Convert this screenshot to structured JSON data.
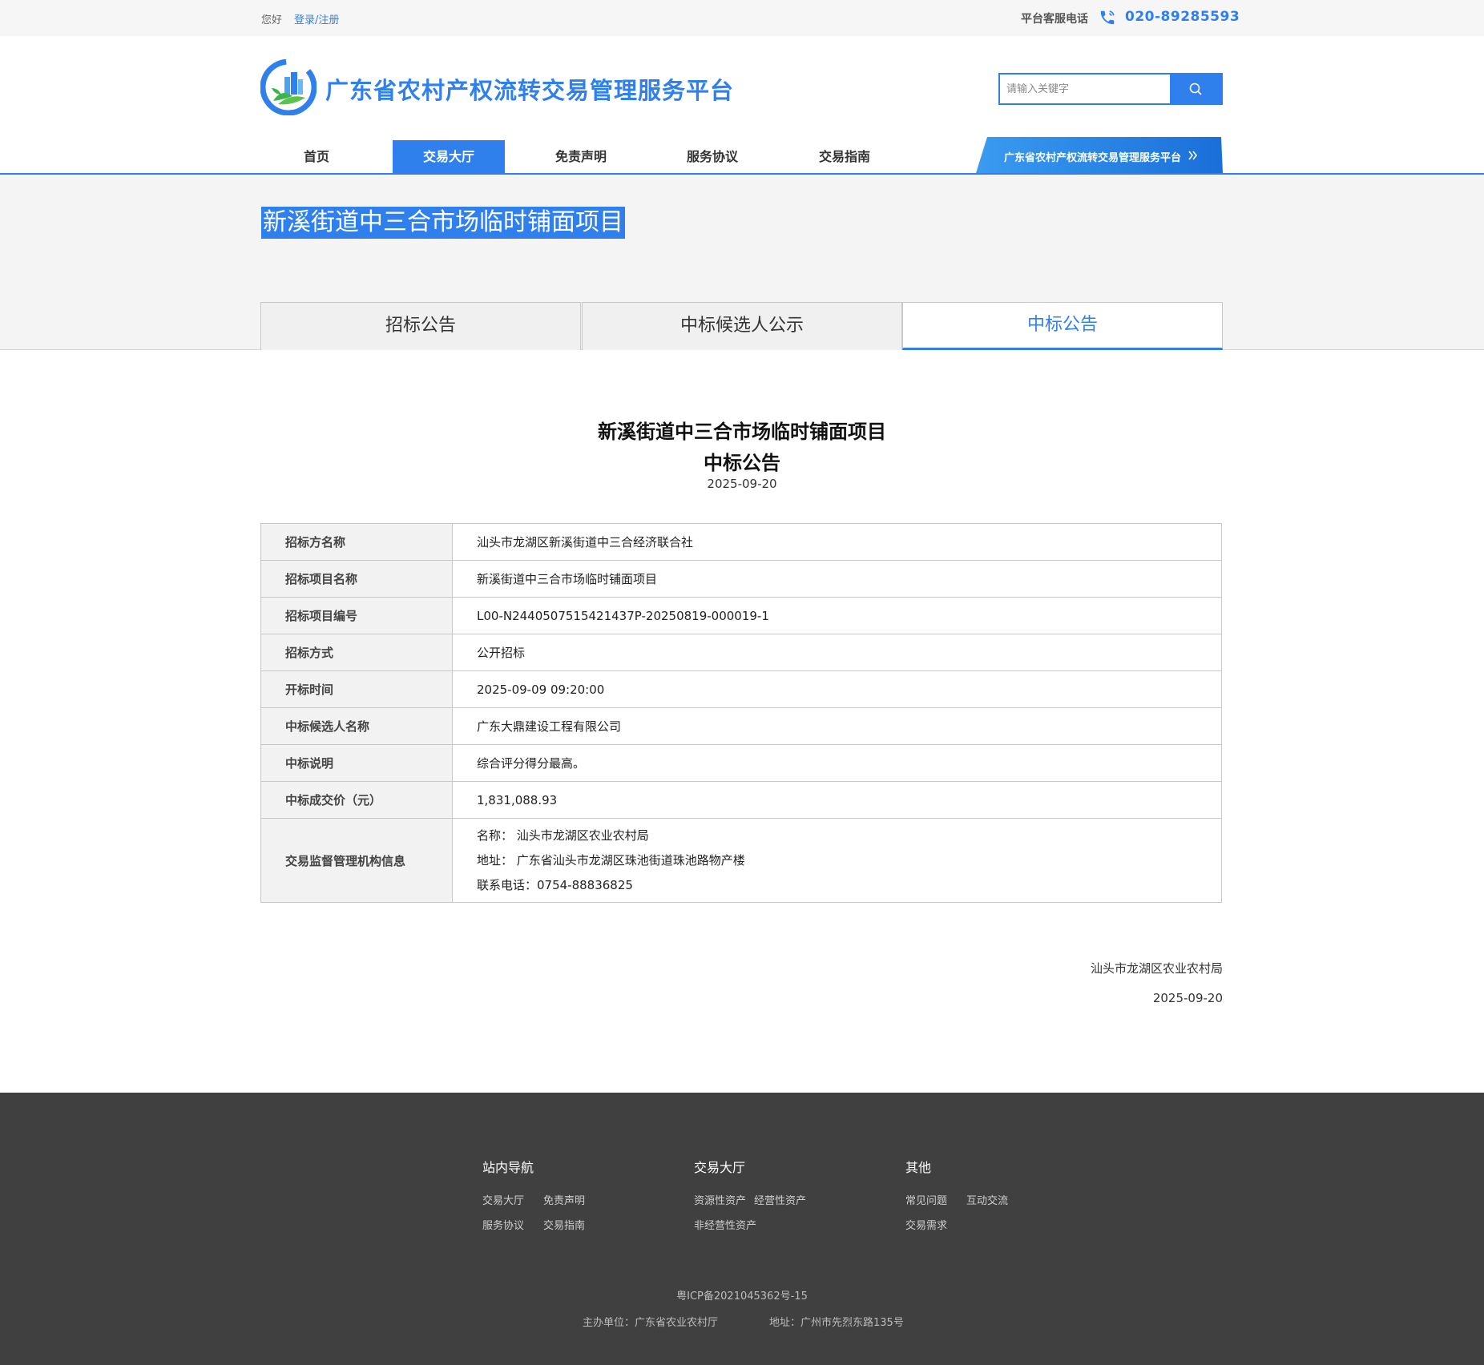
{
  "topbar": {
    "greeting": "您好",
    "login_link": "登录/注册",
    "hotline_label": "平台客服电话",
    "hotline_number": "020-89285593"
  },
  "header": {
    "site_title": "广东省农村产权流转交易管理服务平台",
    "logo_icon": "rural-platform-logo",
    "search_placeholder": "请输入关键字",
    "search_icon": "search-icon"
  },
  "nav": {
    "items": [
      {
        "label": "首页",
        "active": false
      },
      {
        "label": "交易大厅",
        "active": true
      },
      {
        "label": "免责声明",
        "active": false
      },
      {
        "label": "服务协议",
        "active": false
      },
      {
        "label": "交易指南",
        "active": false
      }
    ],
    "banner_label": "广东省农村产权流转交易管理服务平台"
  },
  "project": {
    "title": "新溪街道中三合市场临时铺面项目",
    "tabs": [
      {
        "label": "招标公告",
        "active": false
      },
      {
        "label": "中标候选人公示",
        "active": false
      },
      {
        "label": "中标公告",
        "active": true
      }
    ]
  },
  "notice": {
    "title_line1": "新溪街道中三合市场临时铺面项目",
    "title_line2": "中标公告",
    "date": "2025-09-20",
    "rows": [
      {
        "key": "招标方名称",
        "value": "汕头市龙湖区新溪街道中三合经济联合社"
      },
      {
        "key": "招标项目名称",
        "value": "新溪街道中三合市场临时铺面项目"
      },
      {
        "key": "招标项目编号",
        "value": "L00-N2440507515421437P-20250819-000019-1"
      },
      {
        "key": "招标方式",
        "value": "公开招标"
      },
      {
        "key": "开标时间",
        "value": "2025-09-09 09:20:00"
      },
      {
        "key": "中标候选人名称",
        "value": "广东大鼎建设工程有限公司"
      },
      {
        "key": "中标说明",
        "value": "综合评分得分最高。"
      },
      {
        "key": "中标成交价（元）",
        "value": "1,831,088.93"
      }
    ],
    "supervisor": {
      "key": "交易监督管理机构信息",
      "name_line": "名称：  汕头市龙湖区农业农村局",
      "address_line": "地址：  广东省汕头市龙湖区珠池街道珠池路物产楼",
      "phone_line": "联系电话：0754-88836825"
    },
    "signature_org": "汕头市龙湖区农业农村局",
    "signature_date": "2025-09-20"
  },
  "footer": {
    "columns": [
      {
        "title": "站内导航",
        "links": [
          "交易大厅",
          "免责声明",
          "服务协议",
          "交易指南"
        ]
      },
      {
        "title": "交易大厅",
        "links": [
          "资源性资产",
          "经营性资产",
          "非经营性资产"
        ]
      },
      {
        "title": "其他",
        "links": [
          "常见问题",
          "互动交流",
          "交易需求"
        ]
      }
    ],
    "icp": "粤ICP备2021045362号-15",
    "sponsor": "主办单位：广东省农业农村厅",
    "address": "地址：广州市先烈东路135号"
  },
  "colors": {
    "accent": "#2f80ed",
    "footer_bg": "#404040",
    "band_bg": "#f4f4f4"
  }
}
